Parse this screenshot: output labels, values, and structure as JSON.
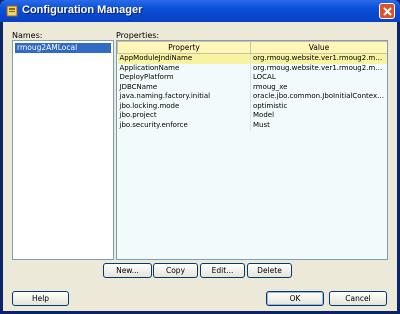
{
  "window": {
    "title": "Configuration Manager"
  },
  "names": {
    "label": "Names:",
    "items": [
      {
        "label": "rmoug2AMLocal",
        "selected": true
      }
    ]
  },
  "properties": {
    "label": "Properties:",
    "columns": [
      "Property",
      "Value"
    ],
    "rows": [
      {
        "property": "AppModuleJndiName",
        "value": "org.rmoug.website.ver1.rmoug2.mo..."
      },
      {
        "property": "ApplicationName",
        "value": "org.rmoug.website.ver1.rmoug2.mo..."
      },
      {
        "property": "DeployPlatform",
        "value": "LOCAL"
      },
      {
        "property": "JDBCName",
        "value": "rmoug_xe"
      },
      {
        "property": "java.naming.factory.initial",
        "value": "oracle.jbo.common.JboInitialContext..."
      },
      {
        "property": "jbo.locking.mode",
        "value": "optimistic"
      },
      {
        "property": "jbo.project",
        "value": "Model"
      },
      {
        "property": "jbo.security.enforce",
        "value": "Must"
      }
    ]
  },
  "actions": {
    "new": "New...",
    "copy": "Copy",
    "edit": "Edit...",
    "delete": "Delete"
  },
  "footer": {
    "help": "Help",
    "ok": "OK",
    "cancel": "Cancel"
  },
  "colors": {
    "titlebar": "#0a4fd8",
    "selection": "#316ac5",
    "header": "#fff6b8",
    "close": "#d9532b"
  }
}
